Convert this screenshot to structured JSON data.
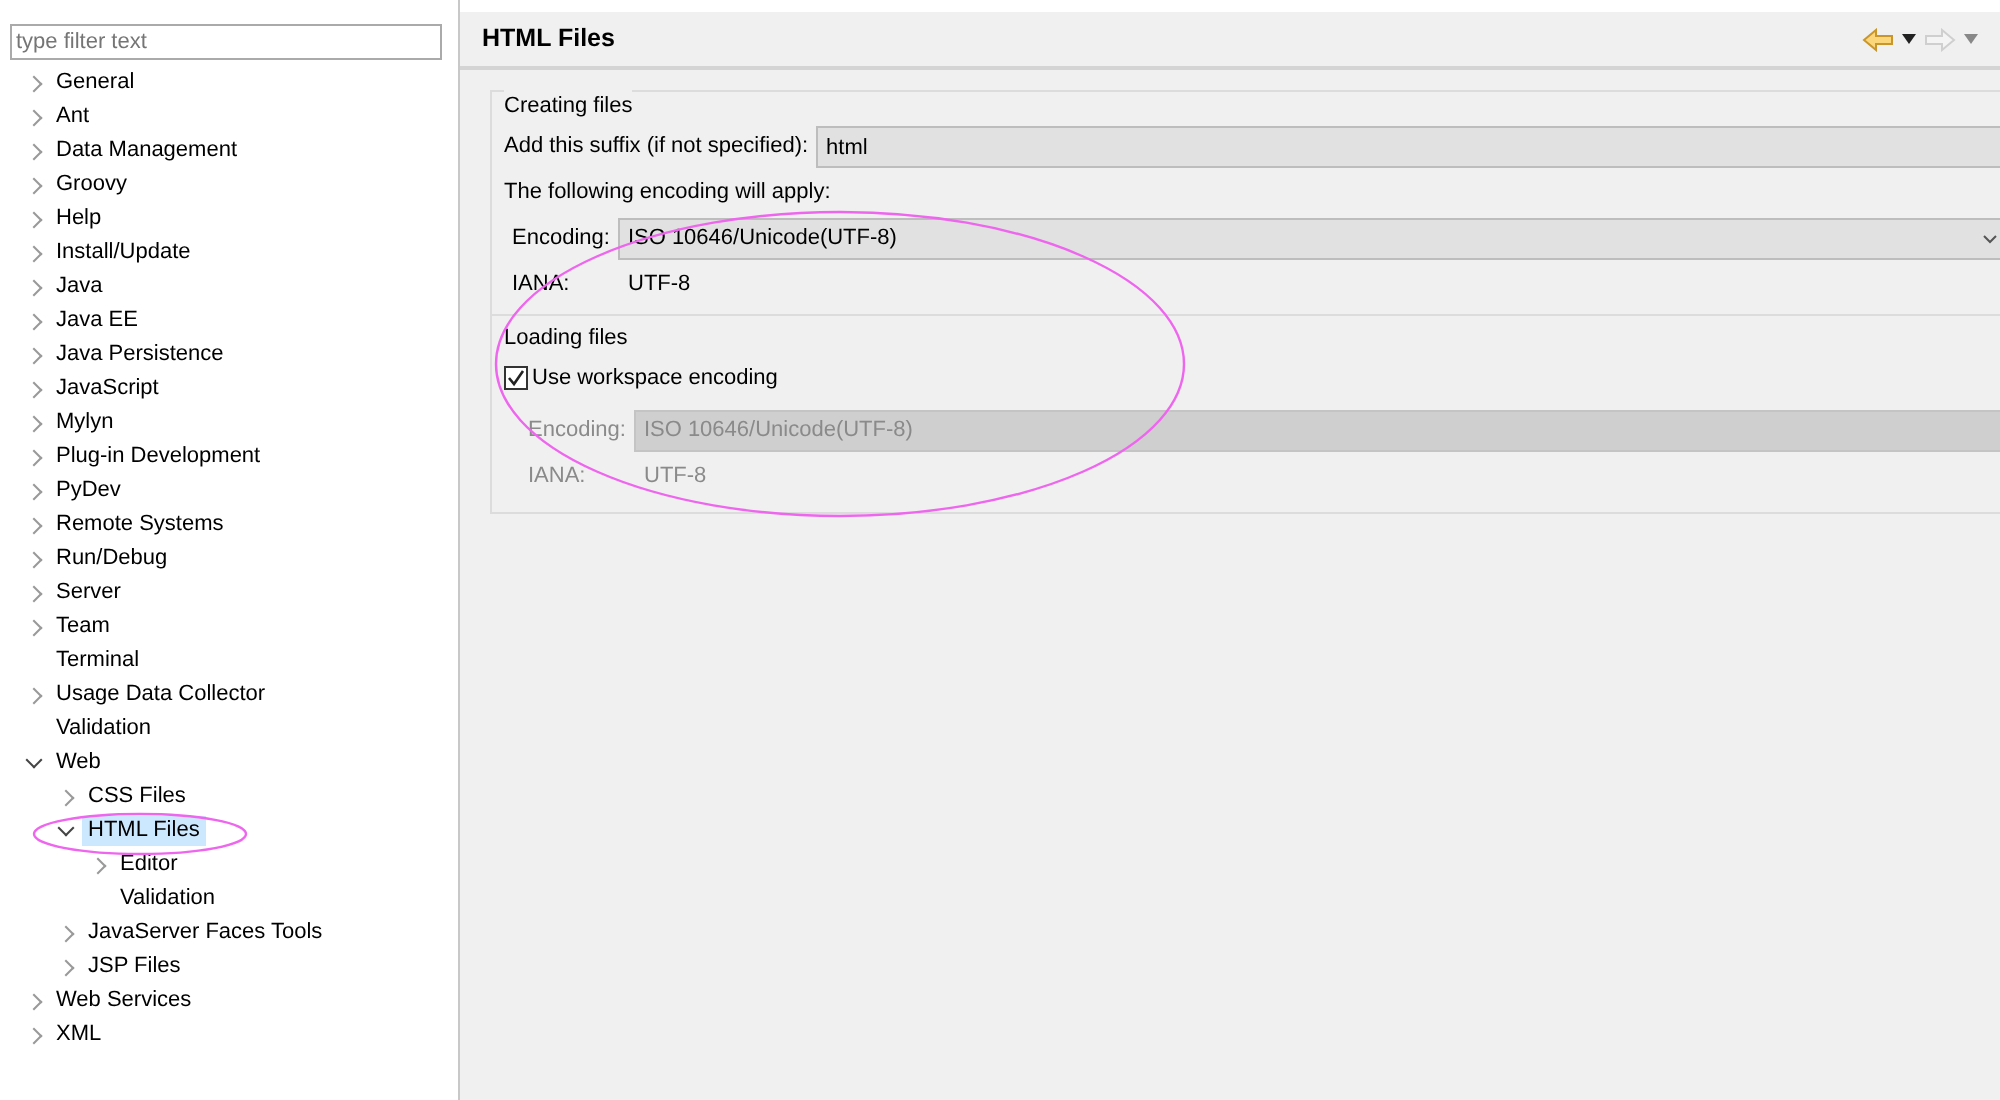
{
  "filter": {
    "placeholder": "type filter text"
  },
  "tree": [
    {
      "label": "General",
      "expanded": false,
      "selected": false
    },
    {
      "label": "Ant",
      "expanded": false,
      "selected": false
    },
    {
      "label": "Data Management",
      "expanded": false,
      "selected": false
    },
    {
      "label": "Groovy",
      "expanded": false,
      "selected": false
    },
    {
      "label": "Help",
      "expanded": false,
      "selected": false
    },
    {
      "label": "Install/Update",
      "expanded": false,
      "selected": false
    },
    {
      "label": "Java",
      "expanded": false,
      "selected": false
    },
    {
      "label": "Java EE",
      "expanded": false,
      "selected": false
    },
    {
      "label": "Java Persistence",
      "expanded": false,
      "selected": false
    },
    {
      "label": "JavaScript",
      "expanded": false,
      "selected": false
    },
    {
      "label": "Mylyn",
      "expanded": false,
      "selected": false
    },
    {
      "label": "Plug-in Development",
      "expanded": false,
      "selected": false
    },
    {
      "label": "PyDev",
      "expanded": false,
      "selected": false
    },
    {
      "label": "Remote Systems",
      "expanded": false,
      "selected": false
    },
    {
      "label": "Run/Debug",
      "expanded": false,
      "selected": false
    },
    {
      "label": "Server",
      "expanded": false,
      "selected": false
    },
    {
      "label": "Team",
      "expanded": false,
      "selected": false
    },
    {
      "label": "Terminal",
      "selected": false
    },
    {
      "label": "Usage Data Collector",
      "expanded": false,
      "selected": false
    },
    {
      "label": "Validation",
      "selected": false
    },
    {
      "label": "Web",
      "expanded": true,
      "selected": false,
      "children": [
        {
          "label": "CSS Files",
          "expanded": false,
          "selected": false
        },
        {
          "label": "HTML Files",
          "expanded": true,
          "selected": true,
          "children": [
            {
              "label": "Editor",
              "expanded": false,
              "selected": false
            },
            {
              "label": "Validation",
              "selected": false
            }
          ]
        },
        {
          "label": "JavaServer Faces Tools",
          "expanded": false,
          "selected": false
        },
        {
          "label": "JSP Files",
          "expanded": false,
          "selected": false
        }
      ]
    },
    {
      "label": "Web Services",
      "expanded": false,
      "selected": false
    },
    {
      "label": "XML",
      "expanded": false,
      "selected": false
    }
  ],
  "page": {
    "title": "HTML Files",
    "back_disabled": false,
    "forward_disabled": true
  },
  "creating": {
    "title": "Creating files",
    "suffix_label": "Add this suffix (if not specified):",
    "suffix_value": "html",
    "encoding_note": "The following encoding will apply:",
    "encoding_label": "Encoding:",
    "encoding_value": "ISO 10646/Unicode(UTF-8)",
    "iana_label": "IANA:",
    "iana_value": "UTF-8",
    "disabled": false
  },
  "loading": {
    "title": "Loading files",
    "checkbox_label": "Use workspace encoding",
    "checked": true,
    "encoding_label": "Encoding:",
    "encoding_value": "ISO 10646/Unicode(UTF-8)",
    "iana_label": "IANA:",
    "iana_value": "UTF-8",
    "disabled": true
  }
}
